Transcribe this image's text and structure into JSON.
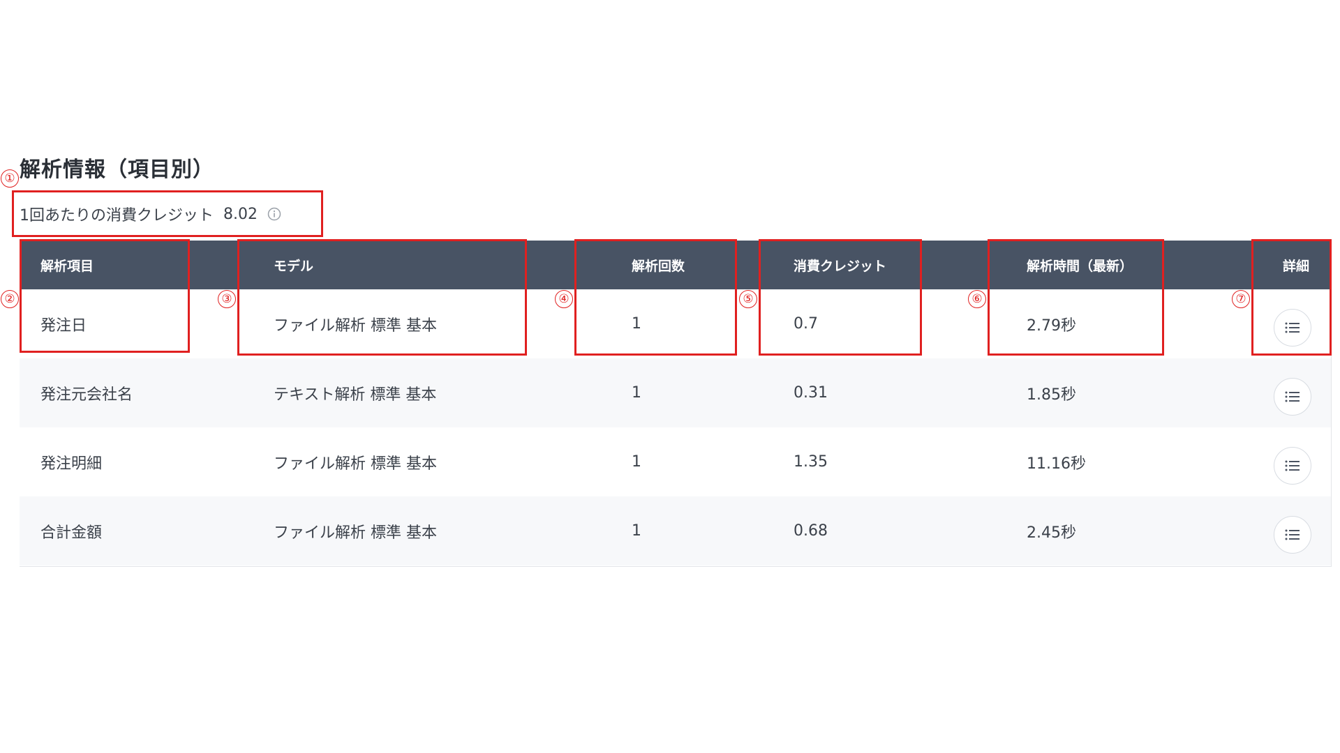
{
  "section": {
    "title": "解析情報（項目別）",
    "credit_label": "1回あたりの消費クレジット",
    "credit_value": "8.02"
  },
  "table": {
    "headers": {
      "item": "解析項目",
      "model": "モデル",
      "count": "解析回数",
      "credit": "消費クレジット",
      "time": "解析時間（最新）",
      "detail": "詳細"
    },
    "rows": [
      {
        "item": "発注日",
        "model": "ファイル解析 標準 基本",
        "count": "1",
        "credit": "0.7",
        "time": "2.79秒"
      },
      {
        "item": "発注元会社名",
        "model": "テキスト解析 標準 基本",
        "count": "1",
        "credit": "0.31",
        "time": "1.85秒"
      },
      {
        "item": "発注明細",
        "model": "ファイル解析 標準 基本",
        "count": "1",
        "credit": "1.35",
        "time": "11.16秒"
      },
      {
        "item": "合計金額",
        "model": "ファイル解析 標準 基本",
        "count": "1",
        "credit": "0.68",
        "time": "2.45秒"
      }
    ]
  },
  "annotations": [
    "①",
    "②",
    "③",
    "④",
    "⑤",
    "⑥",
    "⑦"
  ],
  "colors": {
    "header_bg": "#485364",
    "annotation": "#e02020",
    "alt_row_bg": "#f7f8fa"
  },
  "icons": {
    "info": "info-circle-icon",
    "detail": "list-icon"
  }
}
